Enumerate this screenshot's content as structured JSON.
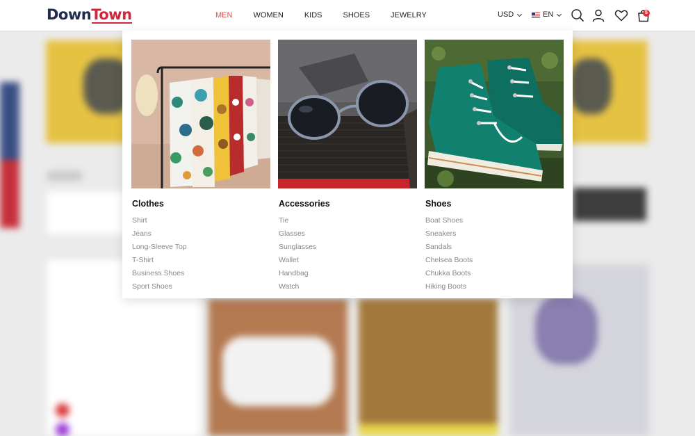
{
  "header": {
    "logo": {
      "part1": "Down",
      "part2": "Town"
    },
    "nav": [
      {
        "label": "MEN",
        "active": true
      },
      {
        "label": "WOMEN",
        "active": false
      },
      {
        "label": "KIDS",
        "active": false
      },
      {
        "label": "SHOES",
        "active": false
      },
      {
        "label": "JEWELRY",
        "active": false
      }
    ],
    "currency": "USD",
    "language": "EN",
    "icons": [
      "search-icon",
      "user-icon",
      "heart-icon",
      "bag-icon"
    ],
    "cart_count": "5"
  },
  "mega_menu": {
    "columns": [
      {
        "title": "Clothes",
        "image": "clothes-rack-image",
        "items": [
          "Shirt",
          "Jeans",
          "Long-Sleeve Top",
          "T-Shirt",
          "Business Shoes",
          "Sport Shoes"
        ]
      },
      {
        "title": "Accessories",
        "image": "sunglasses-image",
        "items": [
          "Tie",
          "Glasses",
          "Sunglasses",
          "Wallet",
          "Handbag",
          "Watch"
        ]
      },
      {
        "title": "Shoes",
        "image": "green-boots-image",
        "items": [
          "Boat Shoes",
          "Sneakers",
          "Sandals",
          "Chelsea Boots",
          "Chukka Boots",
          "Hiking Boots"
        ]
      }
    ]
  },
  "colors": {
    "brand_navy": "#1f2b4c",
    "brand_red": "#d0283a",
    "active_nav": "#e04a4a",
    "badge": "#e0303a"
  }
}
